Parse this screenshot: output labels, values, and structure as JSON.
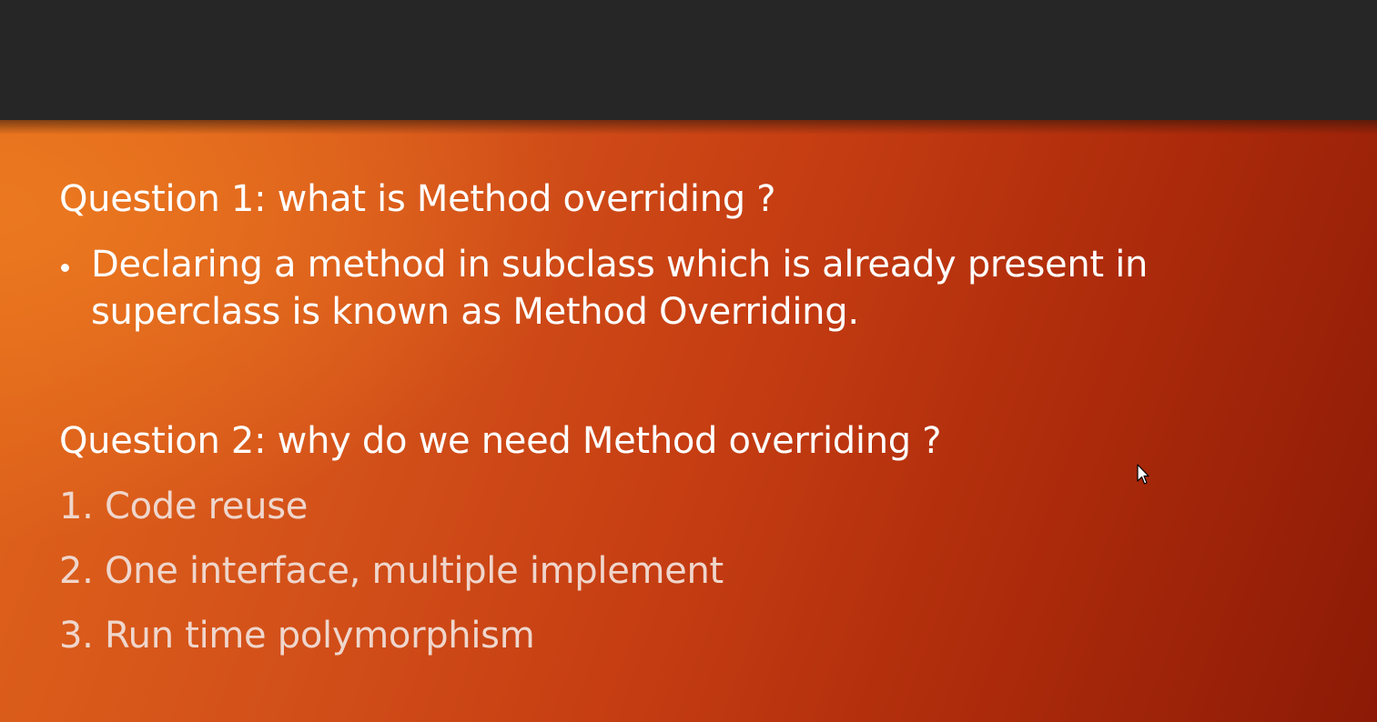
{
  "slide": {
    "question1": {
      "heading": "Question 1: what is Method overriding ?",
      "bullet_line1": "Declaring a method in subclass which is already present in",
      "bullet_line2": "superclass is known as Method Overriding."
    },
    "question2": {
      "heading": "Question 2: why do we need Method overriding ?",
      "items": [
        "1. Code reuse",
        "2. One interface, multiple implement",
        "3. Run time polymorphism"
      ]
    }
  },
  "colors": {
    "top_bar": "#262626",
    "slide_orange": "#e1661b",
    "slide_red": "#8c1a06",
    "heading_text": "#ffffff",
    "list_text": "#efd6cc"
  },
  "icons": {
    "cursor": "mouse-pointer-icon",
    "bullet": "bullet-dot-icon"
  }
}
